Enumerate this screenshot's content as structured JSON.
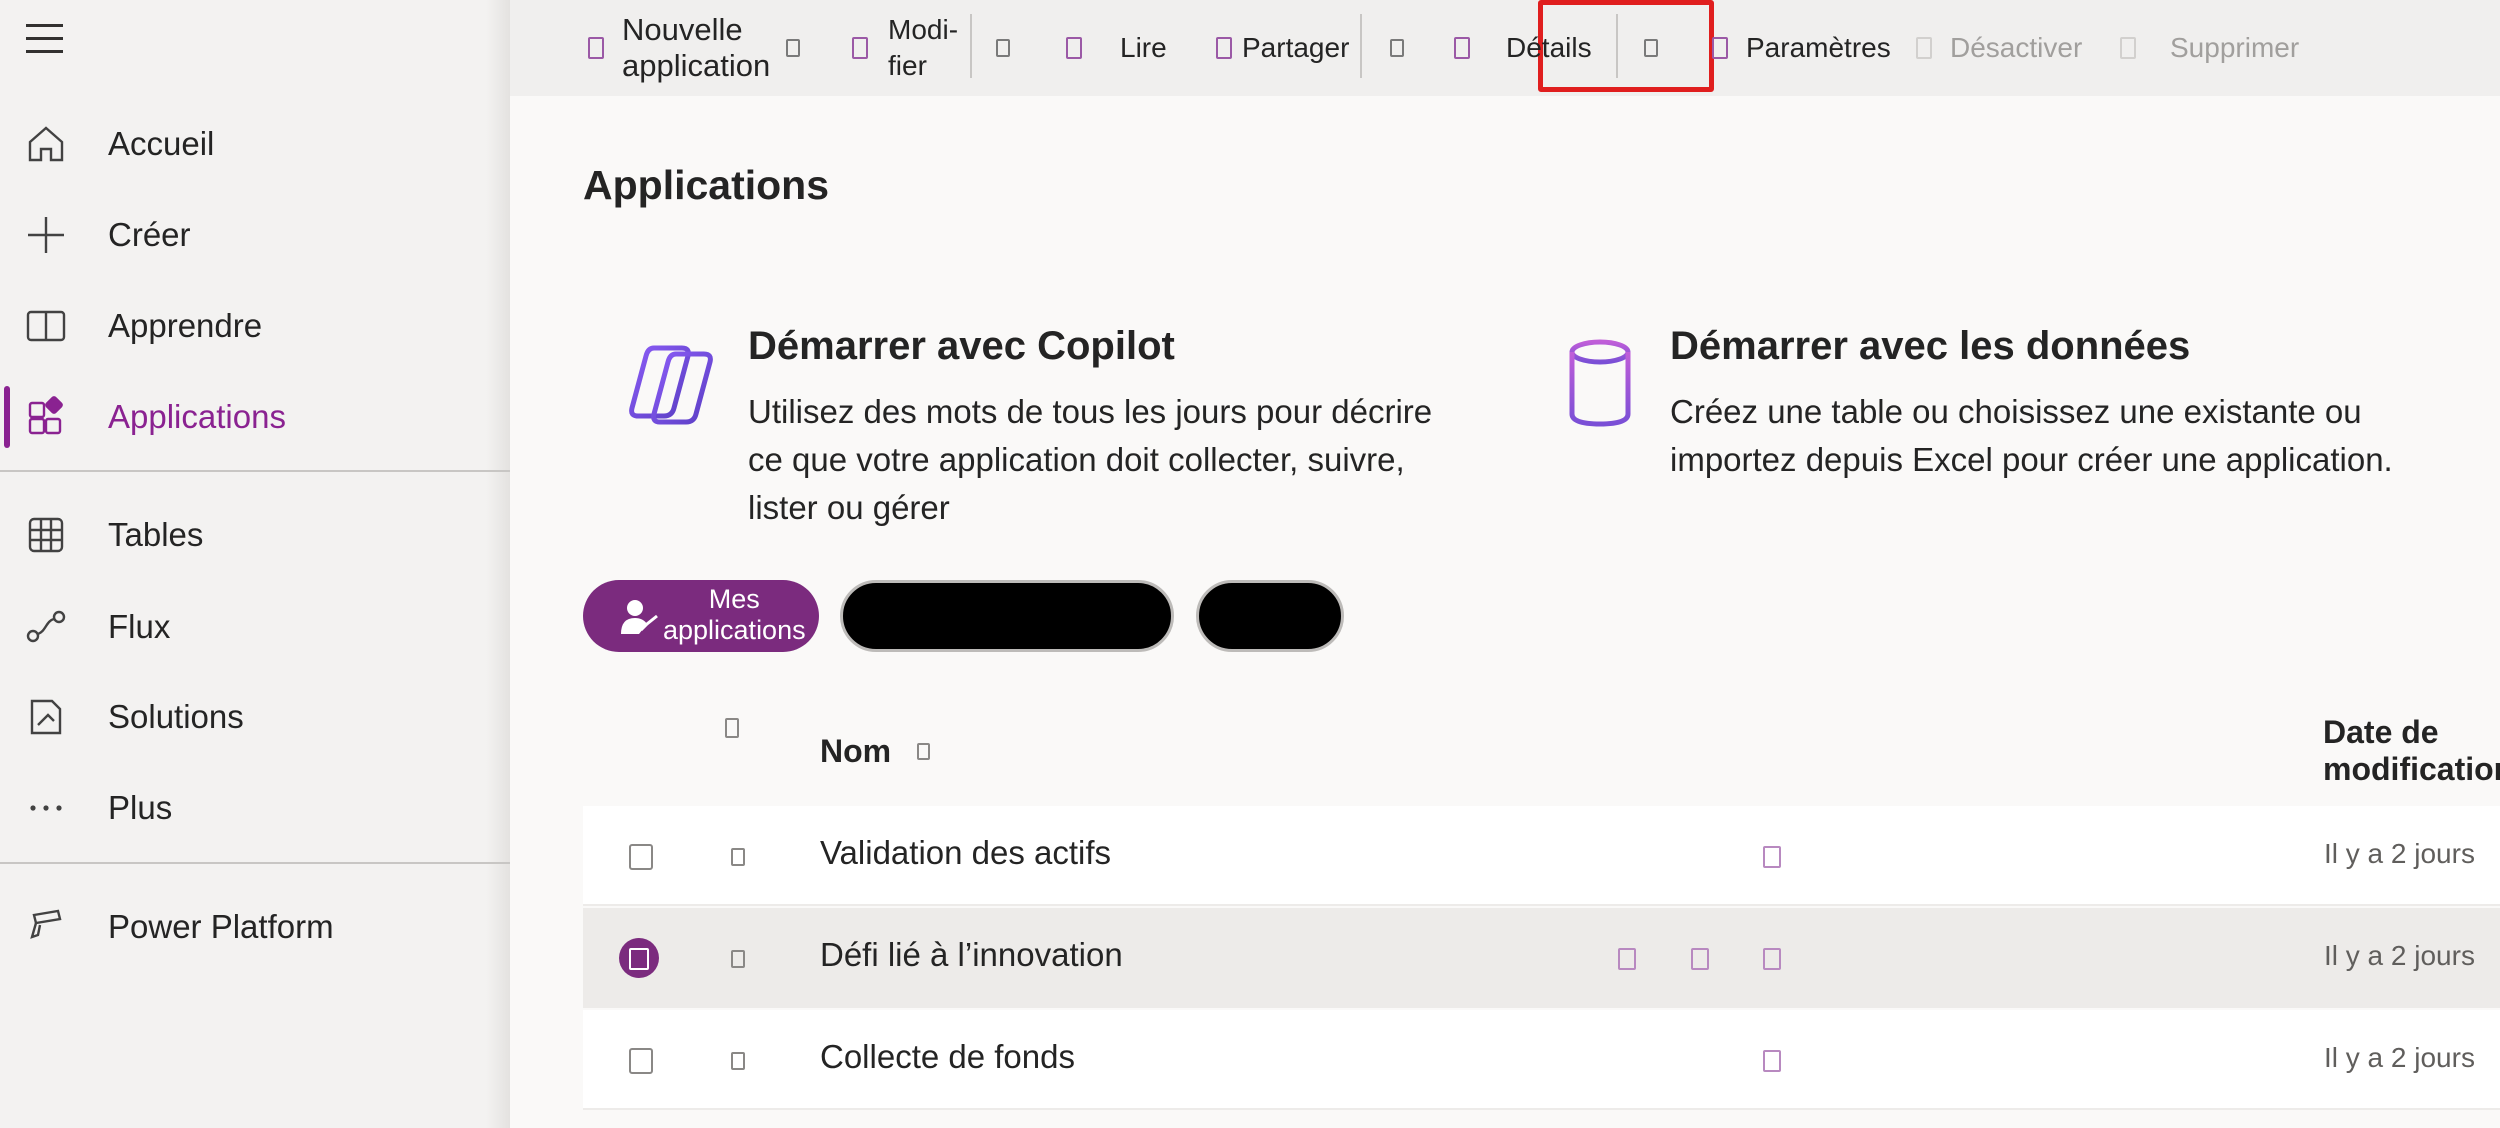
{
  "sidebar": {
    "items": [
      {
        "label": "Accueil",
        "icon": "home-icon"
      },
      {
        "label": "Créer",
        "icon": "plus-icon"
      },
      {
        "label": "Apprendre",
        "icon": "book-icon"
      },
      {
        "label": "Applications",
        "icon": "apps-icon",
        "active": true
      },
      {
        "label": "Tables",
        "icon": "table-grid-icon"
      },
      {
        "label": "Flux",
        "icon": "flow-icon"
      },
      {
        "label": "Solutions",
        "icon": "solutions-icon"
      },
      {
        "label": "Plus",
        "icon": "more-icon"
      },
      {
        "label": "Power Platform",
        "icon": "power-platform-icon"
      }
    ]
  },
  "toolbar": {
    "new_app_line1": "Nouvelle",
    "new_app_line2": "application",
    "edit_line1": "Modi-",
    "edit_line2": "fier",
    "play_label": "Lire",
    "share_label": "Partager",
    "details_label": "Détails",
    "settings_label": "Paramètres",
    "deactivate_label": "Désactiver",
    "delete_label": "Supprimer"
  },
  "main": {
    "title": "Applications",
    "cards": [
      {
        "title": "Démarrer avec Copilot",
        "desc_lines": [
          "Utilisez des mots de tous les jours pour décrire",
          "ce que votre application doit collecter, suivre,",
          "lister ou gérer"
        ]
      },
      {
        "title": "Démarrer avec les données",
        "desc_lines": [
          "Créez une table ou choisissez une existante ou",
          "importez depuis Excel pour créer une application."
        ]
      }
    ],
    "filters": {
      "mine_line1": "Mes",
      "mine_line2": "applications"
    },
    "table": {
      "col_name": "Nom",
      "col_modified": "Date de modification",
      "rows": [
        {
          "name": "Validation des actifs",
          "modified": "Il y a 2 jours",
          "selected": false
        },
        {
          "name": "Défi lié à l’innovation",
          "modified": "Il y a 2 jours",
          "selected": true
        },
        {
          "name": "Collecte de fonds",
          "modified": "Il y a 2 jours",
          "selected": false
        }
      ]
    }
  },
  "colors": {
    "accent": "#8a2291",
    "pill": "#7b2b7e",
    "highlight": "#e01e1e"
  }
}
